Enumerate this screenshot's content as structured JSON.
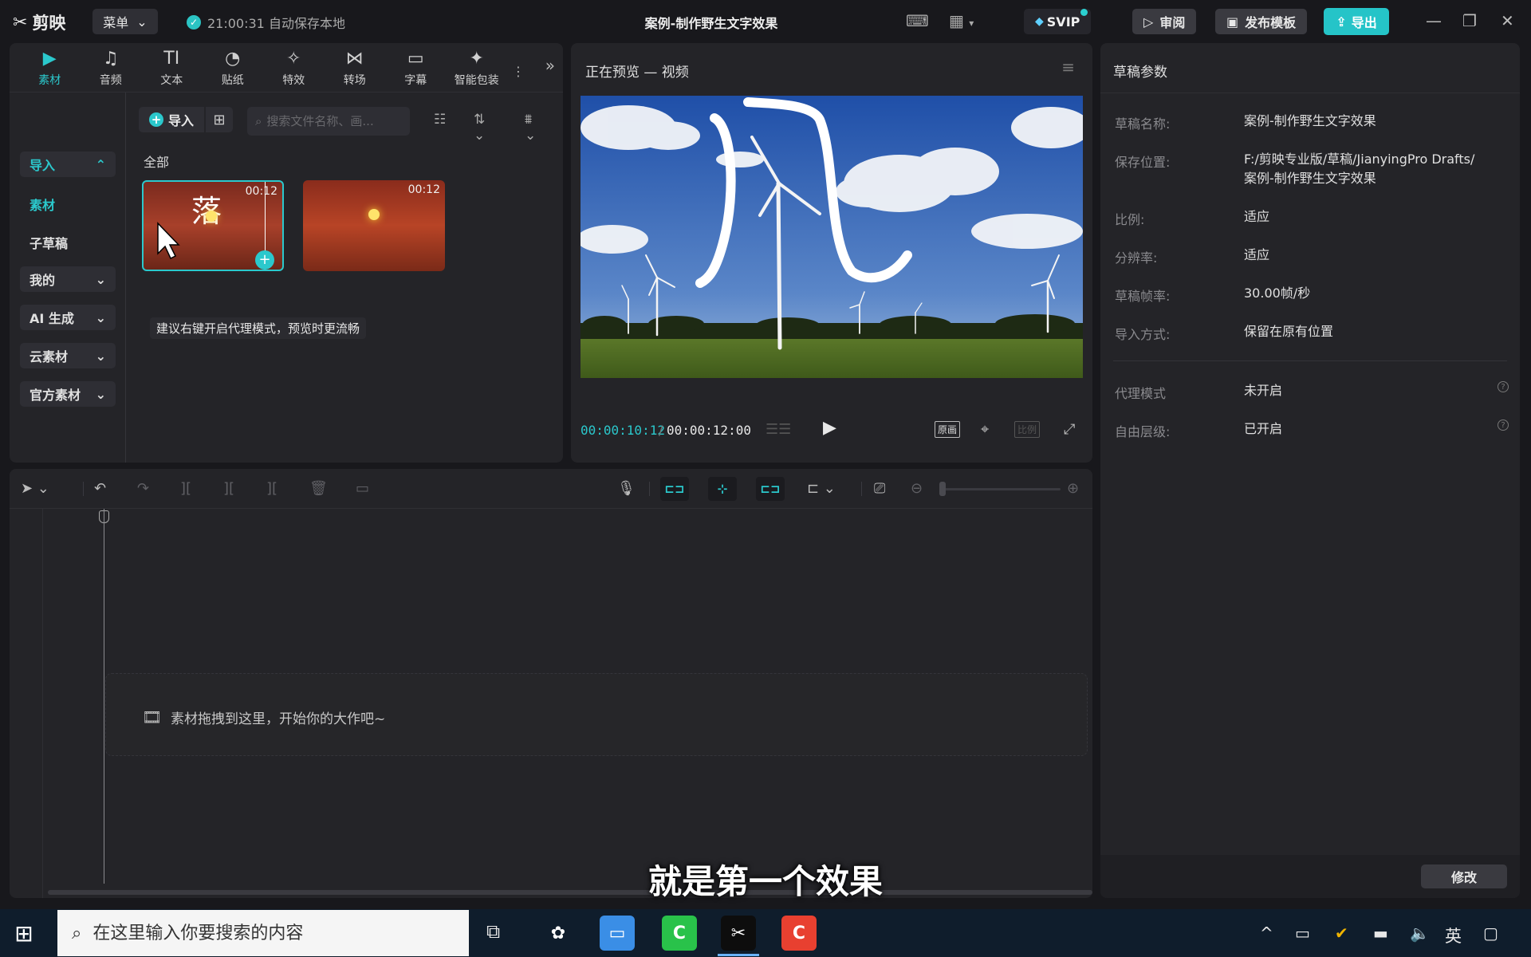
{
  "app": {
    "name": "剪映",
    "menu_label": "菜单",
    "autosave": "21:00:31 自动保存本地",
    "title": "案例-制作野生文字效果",
    "svip": "SVIP",
    "review": "审阅",
    "publish_template": "发布模板",
    "export": "导出"
  },
  "media_tabs": [
    {
      "label": "素材",
      "icon": "media-icon"
    },
    {
      "label": "音频",
      "icon": "audio-icon"
    },
    {
      "label": "文本",
      "icon": "text-icon"
    },
    {
      "label": "贴纸",
      "icon": "sticker-icon"
    },
    {
      "label": "特效",
      "icon": "effects-icon"
    },
    {
      "label": "转场",
      "icon": "transition-icon"
    },
    {
      "label": "字幕",
      "icon": "caption-icon"
    },
    {
      "label": "智能包装",
      "icon": "smart-package-icon"
    }
  ],
  "sidebar": {
    "import": "导入",
    "material": "素材",
    "sub_draft": "子草稿",
    "mine": "我的",
    "ai_gen": "AI 生成",
    "cloud": "云素材",
    "official": "官方素材"
  },
  "media": {
    "import_label": "导入",
    "search_placeholder": "搜索文件名称、画...",
    "section_all": "全部",
    "clips": [
      {
        "duration": "00:12",
        "glyph": "落"
      },
      {
        "duration": "00:12"
      }
    ],
    "tooltip": "建议右键开启代理模式，预览时更流畅"
  },
  "preview": {
    "title": "正在预览 — 视频",
    "overlay_text": "风",
    "time_current": "00:00:10:12",
    "time_total": "00:00:12:00",
    "original_label": "原画",
    "ratio_label": "比例"
  },
  "props": {
    "title": "草稿参数",
    "rows": [
      {
        "label": "草稿名称:",
        "value": "案例-制作野生文字效果"
      },
      {
        "label": "保存位置:",
        "value": "F:/剪映专业版/草稿/JianyingPro Drafts/",
        "value2": "案例-制作野生文字效果"
      },
      {
        "label": "比例:",
        "value": "适应"
      },
      {
        "label": "分辨率:",
        "value": "适应"
      },
      {
        "label": "草稿帧率:",
        "value": "30.00帧/秒"
      },
      {
        "label": "导入方式:",
        "value": "保留在原有位置"
      },
      {
        "label": "代理模式",
        "value": "未开启"
      },
      {
        "label": "自由层级:",
        "value": "已开启"
      }
    ],
    "modify": "修改"
  },
  "timeline": {
    "drop_hint": "素材拖拽到这里，开始你的大作吧~"
  },
  "subtitle": "就是第一个效果",
  "taskbar": {
    "search_placeholder": "在这里输入你要搜索的内容",
    "ime": "英"
  },
  "colors": {
    "accent": "#2bc8cc",
    "background": "#18181c",
    "panel": "#242428"
  }
}
